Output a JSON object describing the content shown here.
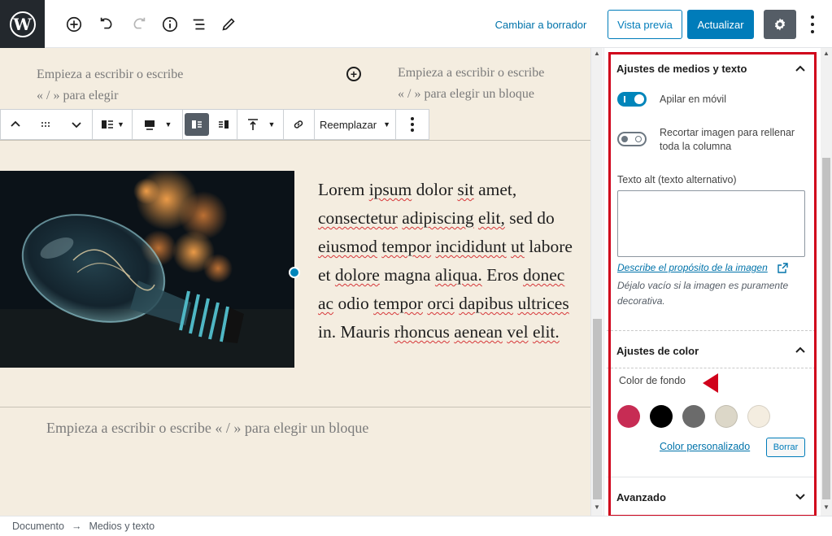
{
  "topbar": {
    "switch_to_draft": "Cambiar a borrador",
    "preview": "Vista previa",
    "update": "Actualizar"
  },
  "editor": {
    "placeholder_left": "Empieza a escribir o escribe « / » para elegir",
    "placeholder_right": "Empieza a escribir o escribe « / » para elegir un bloque",
    "toolbar": {
      "replace_label": "Reemplazar"
    },
    "media_text_words": [
      "Lorem",
      "ipsum",
      "dolor",
      "sit",
      "amet,",
      "consectetur",
      "adipiscing",
      "elit,",
      "sed",
      "do",
      "eiusmod",
      "tempor",
      "incididunt",
      "ut",
      "labore",
      "et",
      "dolore",
      "magna",
      "aliqua.",
      "Eros",
      "donec",
      "ac",
      "odio",
      "tempor",
      "orci",
      "dapibus",
      "ultrices",
      "in.",
      "Mauris",
      "rhoncus",
      "aenean",
      "vel",
      "elit."
    ],
    "bottom_placeholder": "Empieza a escribir o escribe « / » para elegir un bloque"
  },
  "sidebar": {
    "media_text_panel": {
      "title": "Ajustes de medios y texto",
      "stack_on_mobile": "Apilar en móvil",
      "stack_on_mobile_enabled": true,
      "crop_image_line1": "Recortar imagen para rellenar",
      "crop_image_line2": "toda la columna",
      "crop_image_enabled": false,
      "alt_text_label": "Texto alt (texto alternativo)",
      "alt_text_value": "",
      "describe_link": "Describe el propósito de la imagen",
      "help_line1": "Déjalo vacío si la imagen es puramente",
      "help_line2": "decorativa."
    },
    "color_panel": {
      "title": "Ajustes de color",
      "background_label": "Color de fondo",
      "swatches": [
        "#c72c54",
        "#000000",
        "#6b6b6b",
        "#dcd7c8",
        "#f4ede0"
      ],
      "custom_color": "Color personalizado",
      "clear": "Borrar"
    },
    "advanced_panel": {
      "title": "Avanzado"
    }
  },
  "footer": {
    "crumb_document": "Documento",
    "separator": "→",
    "crumb_block": "Medios y texto"
  },
  "colors": {
    "accent": "#007cba",
    "highlight_frame": "#d0021b",
    "editor_background": "#f4ede0"
  }
}
